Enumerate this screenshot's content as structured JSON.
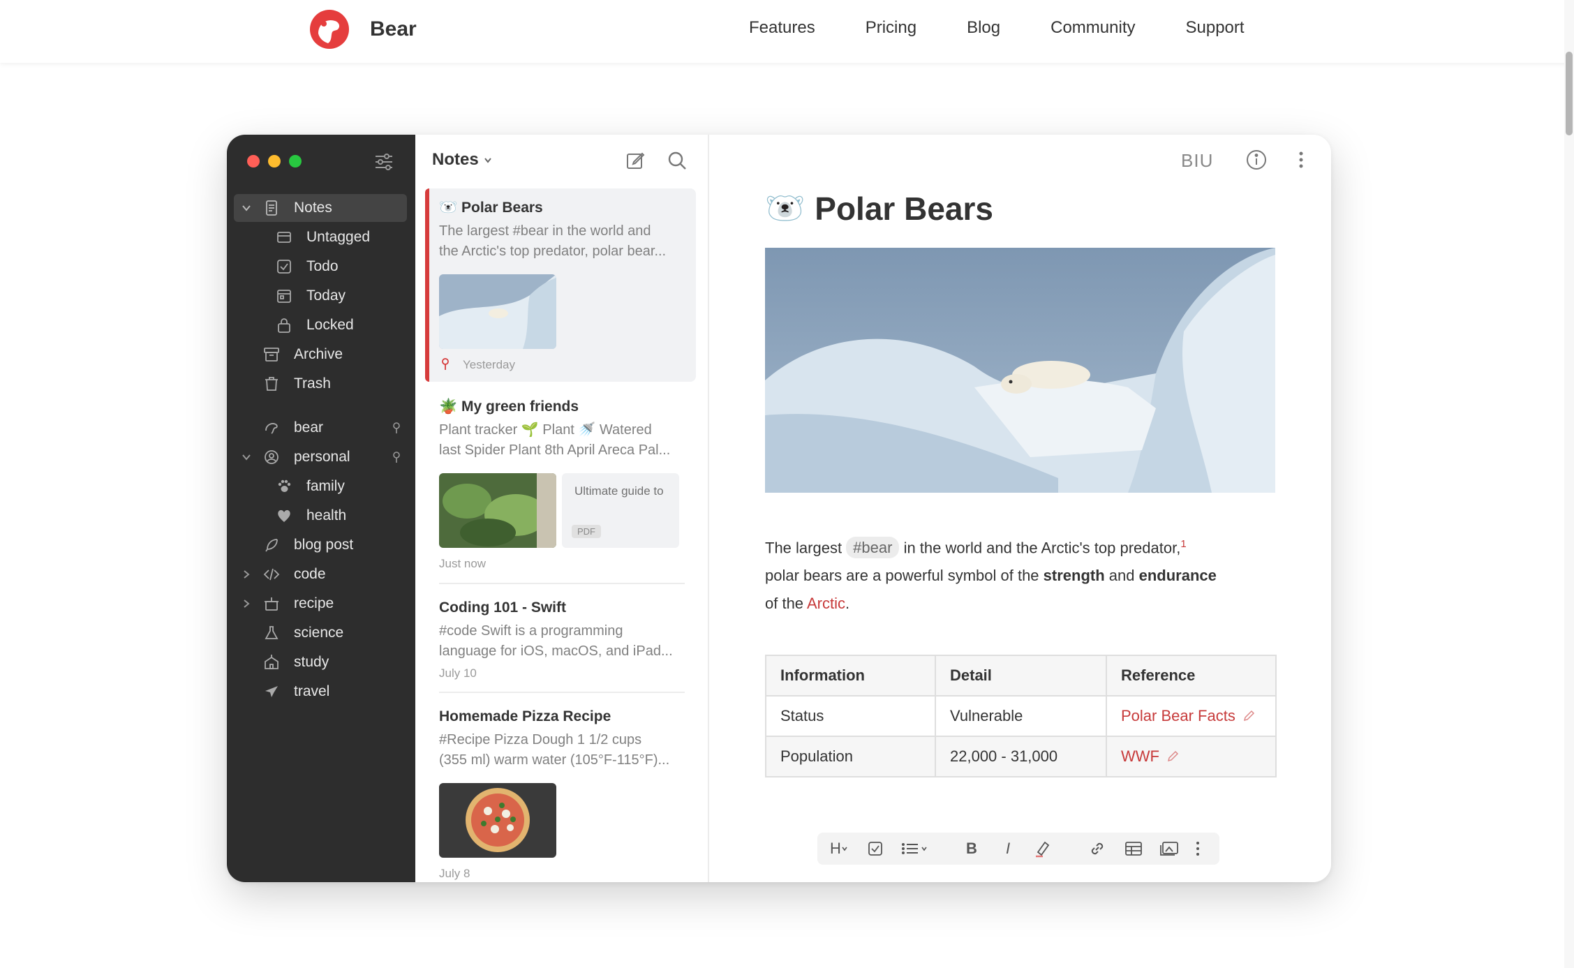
{
  "site": {
    "brand": "Bear",
    "nav": [
      "Features",
      "Pricing",
      "Blog",
      "Community",
      "Support"
    ]
  },
  "colors": {
    "accent": "#d63b3b",
    "sidebar_bg": "#2d2d2d",
    "link": "#c73a3a"
  },
  "sidebar": {
    "items": [
      {
        "label": "Notes",
        "icon": "notes-icon"
      },
      {
        "label": "Untagged",
        "icon": "untagged-icon"
      },
      {
        "label": "Todo",
        "icon": "checkbox-icon"
      },
      {
        "label": "Today",
        "icon": "calendar-icon"
      },
      {
        "label": "Locked",
        "icon": "lock-icon"
      },
      {
        "label": "Archive",
        "icon": "archive-icon"
      },
      {
        "label": "Trash",
        "icon": "trash-icon"
      },
      {
        "label": "bear",
        "icon": "bear-tag-icon"
      },
      {
        "label": "personal",
        "icon": "personal-tag-icon"
      },
      {
        "label": "family",
        "icon": "paw-icon"
      },
      {
        "label": "health",
        "icon": "heart-icon"
      },
      {
        "label": "blog post",
        "icon": "feather-icon"
      },
      {
        "label": "code",
        "icon": "code-icon"
      },
      {
        "label": "recipe",
        "icon": "pot-icon"
      },
      {
        "label": "science",
        "icon": "flask-icon"
      },
      {
        "label": "study",
        "icon": "school-icon"
      },
      {
        "label": "travel",
        "icon": "plane-icon"
      }
    ]
  },
  "notes_list": {
    "title": "Notes",
    "notes": [
      {
        "emoji": "🐻‍❄️",
        "title": "Polar Bears",
        "line1": "The largest #bear in the world and",
        "line2": "the Arctic's top predator, polar bear...",
        "date": "Yesterday"
      },
      {
        "emoji": "🪴",
        "title": "My green friends",
        "line1": "Plant tracker 🌱 Plant 🚿 Watered",
        "line2": "last Spider Plant 8th April Areca Pal...",
        "date": "Just now",
        "attachment_text": "Ultimate guide to",
        "attachment_badge": "PDF"
      },
      {
        "title": "Coding 101 - Swift",
        "line1": "#code Swift is a programming",
        "line2": "language for iOS, macOS, and iPad...",
        "date": "July 10"
      },
      {
        "title": "Homemade Pizza Recipe",
        "line1": "#Recipe Pizza Dough 1 1/2 cups",
        "line2": "(355 ml) warm water (105°F-115°F)...",
        "date": "July 8"
      }
    ]
  },
  "editor": {
    "biu": "BIU",
    "title_emoji": "🐻‍❄️",
    "title": "Polar Bears",
    "para": {
      "p1": "The largest ",
      "tag": "#bear",
      "p2": " in the world and the Arctic's top predator,",
      "sup": "1",
      "p3": "polar bears are a powerful symbol of the ",
      "b1": "strength",
      "p4": " and ",
      "b2": "endurance",
      "p5": "of the ",
      "link": "Arctic",
      "p6": "."
    },
    "table": {
      "headers": [
        "Information",
        "Detail",
        "Reference"
      ],
      "rows": [
        [
          "Status",
          "Vulnerable",
          "Polar Bear Facts"
        ],
        [
          "Population",
          "22,000 - 31,000",
          "WWF"
        ]
      ]
    },
    "toolbar": {
      "heading": "H",
      "bold": "B",
      "italic": "I"
    }
  }
}
